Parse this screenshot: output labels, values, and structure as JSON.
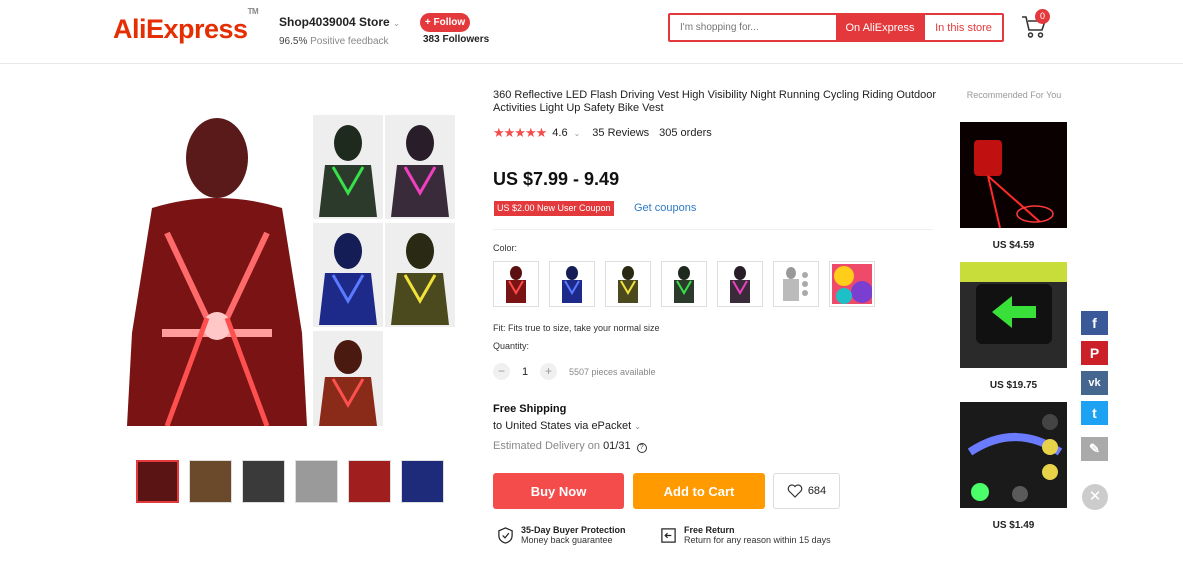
{
  "header": {
    "logo_text": "AliExpress",
    "store_name": "Shop4039004 Store",
    "feedback_percent": "96.5%",
    "feedback_label": "Positive feedback",
    "follow_label": "+ Follow",
    "followers_count": "383",
    "followers_label": "Followers",
    "search_placeholder": "I'm shopping for...",
    "search_all_label": "On AliExpress",
    "search_store_label": "In this store",
    "cart_count": "0"
  },
  "product": {
    "title": "360 Reflective LED Flash Driving Vest High Visibility Night Running Cycling Riding Outdoor Activities Light Up Safety Bike Vest",
    "stars": "★★★★★",
    "rating": "4.6",
    "reviews": "35 Reviews",
    "orders": "305 orders",
    "price": "US $7.99 - 9.49",
    "coupon": "US $2.00 New User Coupon",
    "get_coupons": "Get coupons",
    "color_label": "Color:",
    "colors": [
      {
        "name": "red",
        "hex": "#d41f1f"
      },
      {
        "name": "blue",
        "hex": "#2a4fd6"
      },
      {
        "name": "yellow",
        "hex": "#d8cc1a"
      },
      {
        "name": "green",
        "hex": "#27b83a"
      },
      {
        "name": "pink",
        "hex": "#d8259c"
      },
      {
        "name": "multi",
        "hex": "#888888"
      },
      {
        "name": "rainbow",
        "hex": "#f04a6b"
      }
    ],
    "fit_text": "Fit: Fits true to size, take your normal size",
    "quantity_label": "Quantity:",
    "quantity": "1",
    "available": "5507 pieces available",
    "shipping_title": "Free Shipping",
    "shipping_to": "to United States via ePacket",
    "delivery_label": "Estimated Delivery on",
    "delivery_date": "01/31",
    "buy_now": "Buy Now",
    "add_to_cart": "Add to Cart",
    "wishlist_count": "684",
    "guarantee_title": "35-Day Buyer Protection",
    "guarantee_sub": "Money back guarantee",
    "return_title": "Free Return",
    "return_sub": "Return for any reason within 15 days"
  },
  "recommended": {
    "title": "Recommended For You",
    "items": [
      {
        "price": "US $4.59"
      },
      {
        "price": "US $19.75"
      },
      {
        "price": "US $1.49"
      }
    ]
  },
  "social": {
    "facebook": "f",
    "pinterest": "P",
    "vk": "vk",
    "twitter": "t",
    "edit": "✎",
    "close": "✕"
  },
  "colors": {
    "brand_red": "#e4393c",
    "buy_red": "#f44b4b",
    "cart_orange": "#ff9a00",
    "link_blue": "#2e7bc9"
  }
}
